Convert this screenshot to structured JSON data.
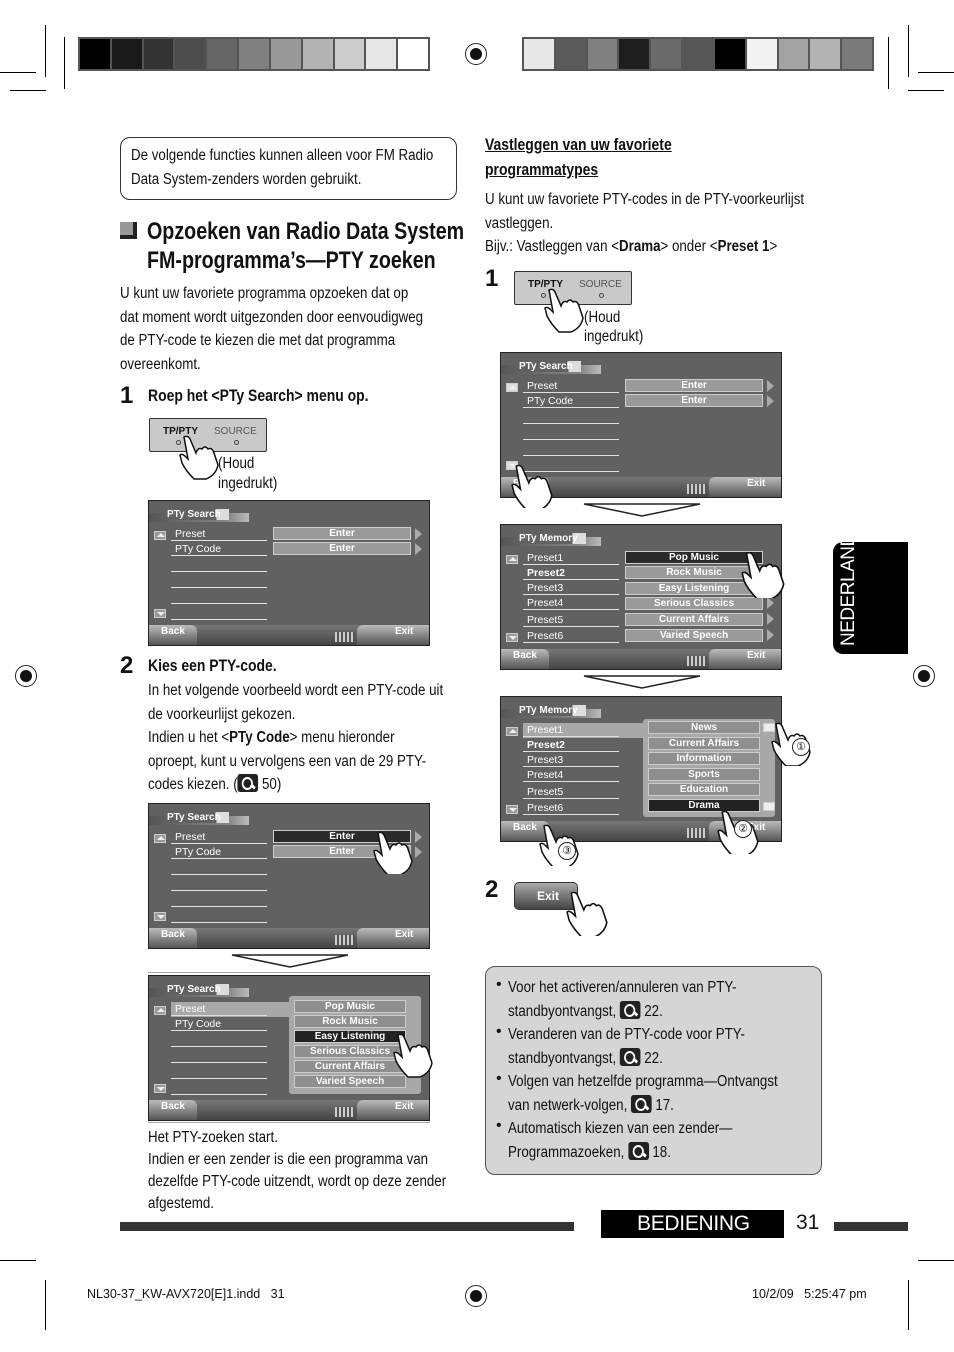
{
  "notice": {
    "line1": "De volgende functies kunnen alleen voor FM Radio",
    "line2": "Data System-zenders worden gebruikt."
  },
  "section1": {
    "title_line1": "Opzoeken van Radio Data System",
    "title_line2": "FM-programma’s—PTY zoeken",
    "intro": [
      "U kunt uw favoriete programma opzoeken dat op",
      "dat moment wordt uitgezonden door eenvoudigweg",
      "de PTY-code te kiezen die met dat programma",
      "overeenkomt."
    ],
    "step1": {
      "num": "1",
      "label": "Roep het <PTy Search> menu op."
    },
    "step2": {
      "num": "2",
      "label": "Kies een PTY-code.",
      "lines": [
        "In het volgende voorbeeld wordt een PTY-code uit",
        "de voorkeurlijst gekozen."
      ],
      "line3_pre": "Indien u het <",
      "line3_bold": "PTy Code",
      "line3_post": "> menu hieronder",
      "line4": "oproept, kunt u vervolgens een van de 29 PTY-",
      "line5_pre": "codes kiezen. (",
      "line5_ref": "50)"
    },
    "result": [
      "Het PTY-zoeken start.",
      "Indien er een zender is die een programma van",
      "dezelfde PTY-code uitzendt, wordt op deze zender",
      "afgestemd."
    ]
  },
  "section2": {
    "title_line1": "Vastleggen van uw favoriete",
    "title_line2": "programmatypes",
    "intro": [
      "U kunt uw favoriete PTY-codes in de PTY-voorkeurlijst",
      "vastleggen."
    ],
    "example_pre": "Bijv.: Vastleggen van <",
    "example_b1": "Drama",
    "example_mid": "> onder <",
    "example_b2": "Preset 1",
    "example_post": ">",
    "step1_num": "1",
    "step2_num": "2"
  },
  "device_button": {
    "tp_pty": "TP/PTY",
    "source": "SOURCE",
    "hold": [
      "(Houd",
      "ingedrukt)"
    ]
  },
  "screens": {
    "pty_search_title": "PTy Search",
    "pty_memory_title": "PTy Memory",
    "rows_search": [
      "Preset",
      "PTy Code"
    ],
    "enter": "Enter",
    "back": "Back",
    "exit": "Exit",
    "presets": [
      "Preset1",
      "Preset2",
      "Preset3",
      "Preset4",
      "Preset5",
      "Preset6"
    ],
    "pty_list_a": [
      "Pop Music",
      "Rock Music",
      "Easy Listening",
      "Serious Classics",
      "Current Affairs",
      "Varied Speech"
    ],
    "pty_list_b": [
      "News",
      "Current Affairs",
      "Information",
      "Sports",
      "Education",
      "Drama"
    ],
    "callouts": [
      "①",
      "②",
      "③"
    ]
  },
  "tips": [
    {
      "l1": "Voor het activeren/annuleren van PTY-",
      "l2": "standbyontvangst,",
      "ref": "22."
    },
    {
      "l1": "Veranderen van de PTY-code voor PTY-",
      "l2": "standbyontvangst,",
      "ref": "22."
    },
    {
      "l1": "Volgen van hetzelfde programma—Ontvangst",
      "l2": "van netwerk-volgen,",
      "ref": "17."
    },
    {
      "l1": "Automatisch kiezen van een zender—",
      "l2": "Programmazoeken,",
      "ref": "18."
    }
  ],
  "side_tab": "NEDERLANDS",
  "footer": {
    "section": "BEDIENING",
    "page": "31",
    "file": "NL30-37_KW-AVX720[E]1.indd   31",
    "timestamp": "10/2/09   5:25:47 pm"
  },
  "colorbar_left": [
    "#000000",
    "#1a1a1a",
    "#333333",
    "#4d4d4d",
    "#666666",
    "#808080",
    "#999999",
    "#b3b3b3",
    "#cccccc",
    "#e6e6e6",
    "#ffffff"
  ],
  "colorbar_right": [
    "#e8e8e8",
    "#5a5a5a",
    "#808080",
    "#1e1e1e",
    "#6a6a6a",
    "#555555",
    "#000000",
    "#f2f2f2",
    "#a3a3a3",
    "#b3b3b3",
    "#7a7a7a"
  ]
}
